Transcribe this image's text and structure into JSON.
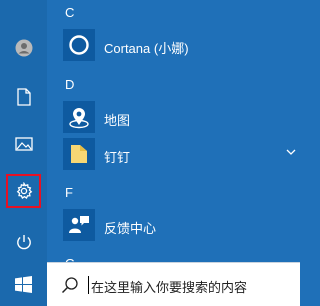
{
  "rail": {
    "items": [
      {
        "name": "user-icon"
      },
      {
        "name": "document-icon"
      },
      {
        "name": "picture-icon"
      },
      {
        "name": "gear-icon",
        "highlight_color": "#e81123"
      },
      {
        "name": "power-icon"
      }
    ]
  },
  "apps": {
    "section_c": "C",
    "cortana": "Cortana (小娜)",
    "section_d": "D",
    "maps": "地图",
    "dingtalk": "钉钉",
    "section_f": "F",
    "feedback": "反馈中心",
    "section_g": "G"
  },
  "search": {
    "placeholder": "在这里输入你要搜索的内容"
  },
  "colors": {
    "accent": "#1f70b8",
    "rail": "#1b69ad",
    "tile": "#0e5aa0",
    "highlight": "#e81123"
  }
}
